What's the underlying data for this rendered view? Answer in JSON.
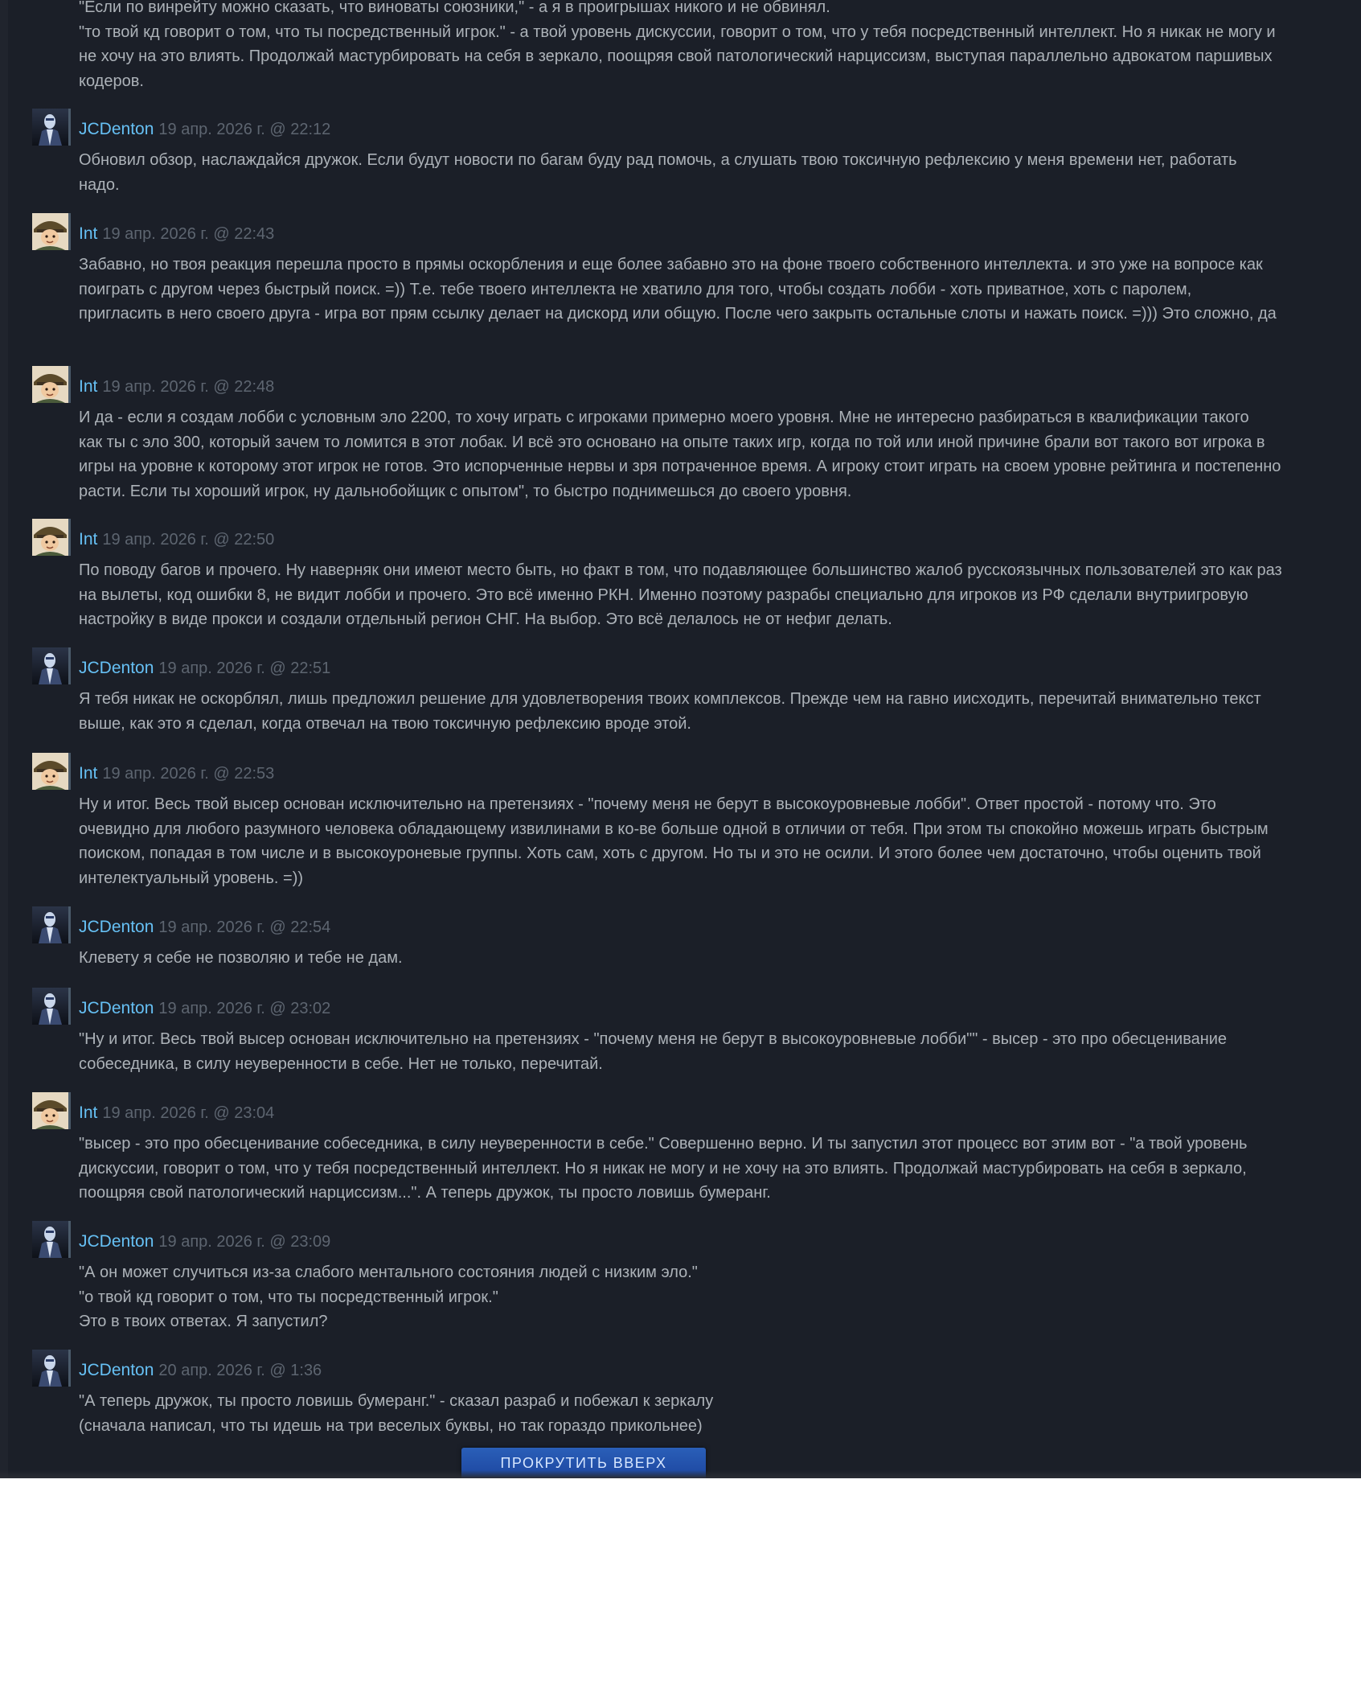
{
  "top_lines": [
    "\"Если по винрейту можно сказать, что виноваты союзники,\" - а я в проигрышах никого и не обвинял.",
    "\"то твой кд говорит о том, что ты посредственный игрок.\" - а твой уровень дискуссии, говорит о том, что у тебя посредственный интеллект. Но я никак не могу и",
    "не хочу на это влиять. Продолжай мастурбировать на себя в зеркало, поощряя свой патологический нарциссизм, выступая параллельно адвокатом паршивых",
    "кодеров."
  ],
  "comments": [
    {
      "author": "JCDenton",
      "avatar": "jcdenton-avatar-icon",
      "date": "19 апр. 2026 г. @ 22:12",
      "lines": [
        "Обновил обзор, наслаждайся дружок. Если будут новости по багам буду рад помочь, а слушать твою токсичную рефлексию у меня времени нет, работать",
        "надо."
      ]
    },
    {
      "author": "Int",
      "avatar": "int-avatar-icon",
      "date": "19 апр. 2026 г. @ 22:43",
      "lines": [
        "Забавно, но твоя реакция перешла просто в прямы оскорбления и еще более забавно это на фоне твоего собственного интеллекта. и это уже на вопросе как",
        "поиграть с другом через быстрый поиск. =)) Т.е. тебе твоего интеллекта не хватило для того, чтобы создать лобби - хоть приватное, хоть с паролем,",
        "пригласить в него своего друга - игра вот прям ссылку делает на дискорд или общую. После чего закрыть остальные слоты и нажать поиск. =))) Это сложно, да"
      ]
    },
    {
      "author": "Int",
      "avatar": "int-avatar-icon",
      "date": "19 апр. 2026 г. @ 22:48",
      "lines": [
        "И да - если я создам лобби с условным эло 2200, то хочу играть с игроками примерно моего уровня. Мне не интересно разбираться в квалификации такого",
        "как ты с эло 300, который зачем то ломится в этот лобак. И всё это основано на опыте таких игр, когда по той или иной причине брали вот такого вот игрока в",
        "игры на уровне к которому этот игрок не готов. Это испорченные нервы и зря потраченное время. А игроку стоит играть на своем уровне рейтинга и постепенно",
        "расти. Если ты хороший игрок, ну дальнобойщик с опытом\", то быстро поднимешься до своего уровня."
      ]
    },
    {
      "author": "Int",
      "avatar": "int-avatar-icon",
      "date": "19 апр. 2026 г. @ 22:50",
      "lines": [
        "По поводу багов и прочего. Ну наверняк они имеют место быть, но факт в том, что подавляющее большинство жалоб русскоязычных пользователей это как раз",
        "на вылеты, код ошибки 8, не видит лобби и прочего. Это всё именно РКН. Именно поэтому разрабы специально для игроков из РФ сделали внутриигровую",
        "настройку в виде прокси и создали отдельный регион СНГ. На выбор. Это всё делалось не от нефиг делать."
      ]
    },
    {
      "author": "JCDenton",
      "avatar": "jcdenton-avatar-icon",
      "date": "19 апр. 2026 г. @ 22:51",
      "lines": [
        "Я тебя никак не оскорблял, лишь предложил решение для удовлетворения твоих комплексов. Прежде чем на гавно иисходить, перечитай внимательно текст",
        "выше, как это я сделал, когда отвечал на твою токсичную рефлексию вроде этой."
      ]
    },
    {
      "author": "Int",
      "avatar": "int-avatar-icon",
      "date": "19 апр. 2026 г. @ 22:53",
      "lines": [
        "Ну и итог. Весь твой высер основан исключительно на претензиях - \"почему меня не берут в высокоуровневые лобби\". Ответ простой - потому что. Это",
        "очевидно для любого разумного человека обладающему извилинами в ко-ве больше одной в отличии от тебя. При этом ты спокойно можешь играть быстрым",
        "поиском, попадая в том числе и в высокоуроневые группы. Хоть сам, хоть с другом. Но ты и это не осили. И этого более чем достаточно, чтобы оценить твой",
        "интелектуальный уровень. =))"
      ]
    },
    {
      "author": "JCDenton",
      "avatar": "jcdenton-avatar-icon",
      "date": "19 апр. 2026 г. @ 22:54",
      "lines": [
        "Клевету я себе не позволяю и тебе не дам."
      ]
    },
    {
      "author": "JCDenton",
      "avatar": "jcdenton-avatar-icon",
      "date": "19 апр. 2026 г. @ 23:02",
      "lines": [
        "\"Ну и итог. Весь твой высер основан исключительно на претензиях - \"почему меня не берут в высокоуровневые лобби\"\" - высер - это про обесценивание",
        "собеседника, в силу неуверенности в себе. Нет не только, перечитай."
      ]
    },
    {
      "author": "Int",
      "avatar": "int-avatar-icon",
      "date": "19 апр. 2026 г. @ 23:04",
      "lines": [
        "\"высер - это про обесценивание собеседника, в силу неуверенности в себе.\" Совершенно верно. И ты запустил этот процесс вот этим вот - \"а твой уровень",
        "дискуссии, говорит о том, что у тебя посредственный интеллект. Но я никак не могу и не хочу на это влиять. Продолжай мастурбировать на себя в зеркало,",
        "поощряя свой патологический нарциссизм...\". А теперь дружок, ты просто ловишь бумеранг."
      ]
    },
    {
      "author": "JCDenton",
      "avatar": "jcdenton-avatar-icon",
      "date": "19 апр. 2026 г. @ 23:09",
      "lines": [
        "\"А он может случиться из-за слабого ментального состояния людей с низким эло.\"",
        "\"о твой кд говорит о том, что ты посредственный игрок.\"",
        "Это в твоих ответах. Я запустил?"
      ]
    },
    {
      "author": "JCDenton",
      "avatar": "jcdenton-avatar-icon",
      "date": "20 апр. 2026 г. @ 1:36",
      "lines": [
        "\"А теперь дружок, ты просто ловишь бумеранг.\" - сказал разраб и побежал к зеркалу",
        "(сначала написал, что ты идешь на три веселых буквы, но так гораздо прикольнее)"
      ]
    }
  ],
  "scroll_top_label": "ПРОКРУТИТЬ ВВЕРХ",
  "colors": {
    "background": "#1b1f28",
    "author": "#66c0f4",
    "text": "#acb2b8",
    "date": "#5d6570",
    "button": "#1f4ea6"
  }
}
